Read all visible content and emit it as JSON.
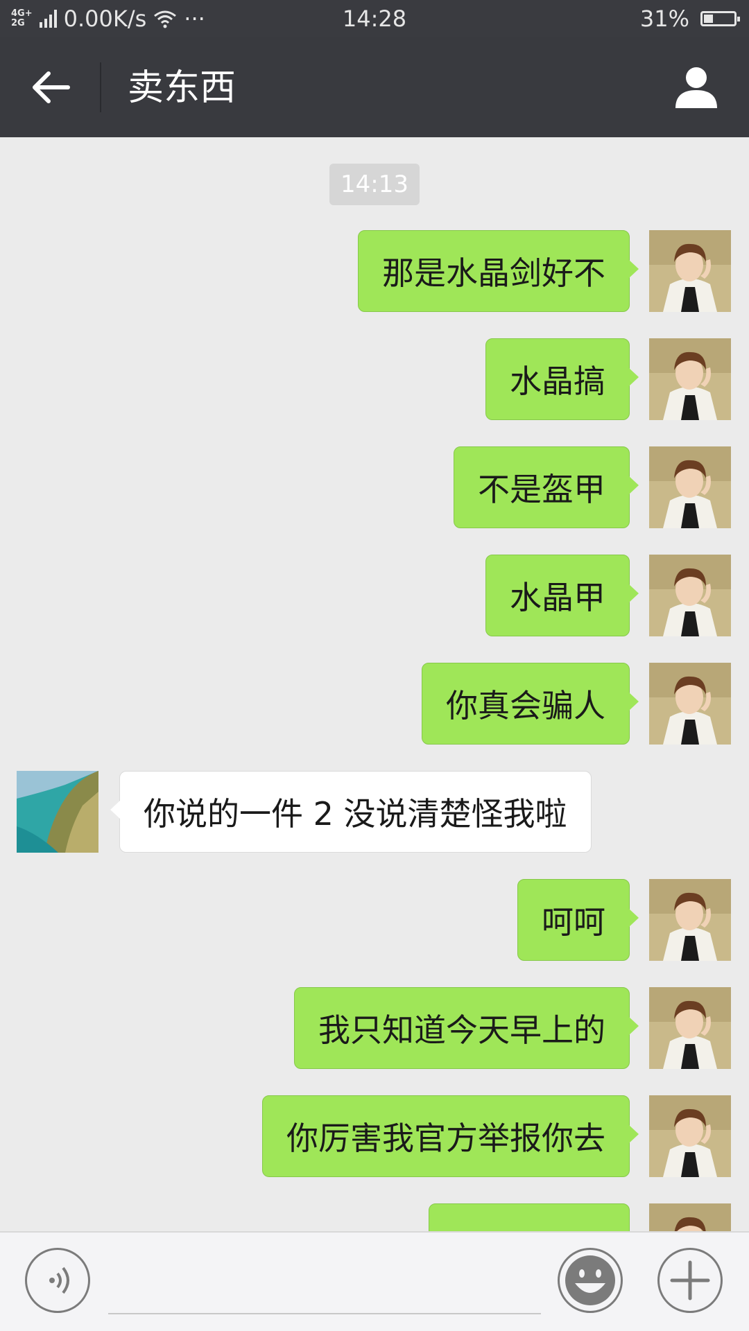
{
  "status_bar": {
    "network": "4G+\n2G",
    "speed": "0.00K/s",
    "more": "···",
    "time": "14:28",
    "battery": "31%",
    "battery_level": 0.31
  },
  "header": {
    "title": "卖东西",
    "back_icon": "arrow-left-icon",
    "profile_icon": "person-icon"
  },
  "conversation": {
    "timestamp": "14:13",
    "messages": [
      {
        "side": "out",
        "text": "那是水晶剑好不"
      },
      {
        "side": "out",
        "text": "水晶搞"
      },
      {
        "side": "out",
        "text": "不是盔甲"
      },
      {
        "side": "out",
        "text": "水晶甲"
      },
      {
        "side": "out",
        "text": "你真会骗人"
      },
      {
        "side": "in",
        "text": "你说的一件 2 没说清楚怪我啦"
      },
      {
        "side": "out",
        "text": "呵呵"
      },
      {
        "side": "out",
        "text": "我只知道今天早上的"
      },
      {
        "side": "out",
        "text": "你厉害我官方举报你去"
      },
      {
        "side": "out",
        "text": ""
      }
    ]
  },
  "input_bar": {
    "voice_icon": "voice-icon",
    "emoji_icon": "emoji-icon",
    "plus_icon": "plus-icon",
    "input_value": ""
  },
  "colors": {
    "outgoing_bubble": "#9fe658",
    "incoming_bubble": "#ffffff",
    "header_bg": "#393a3f",
    "chat_bg": "#ebebeb"
  }
}
